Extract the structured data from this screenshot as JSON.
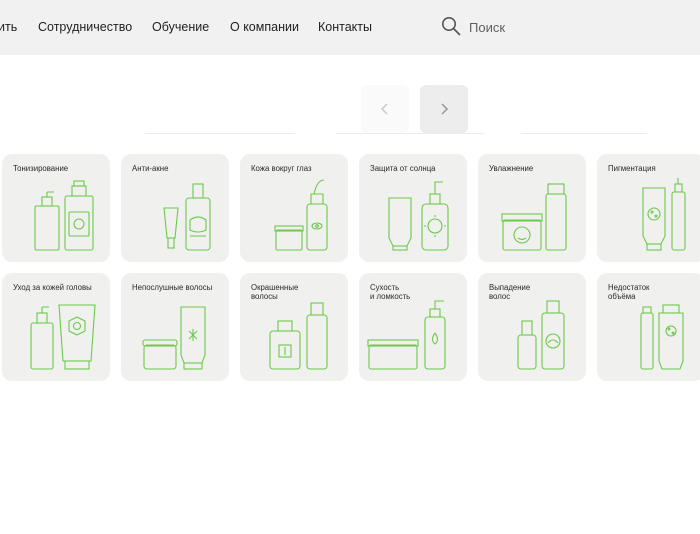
{
  "header": {
    "nav": [
      {
        "id": "nav-item-partial",
        "label": "ить"
      },
      {
        "id": "nav-item-cooperation",
        "label": "Сотрудничество"
      },
      {
        "id": "nav-item-education",
        "label": "Обучение"
      },
      {
        "id": "nav-item-about",
        "label": "О компании"
      },
      {
        "id": "nav-item-contacts",
        "label": "Контакты"
      }
    ],
    "search": {
      "label": "Поиск",
      "icon": "search-icon"
    }
  },
  "carousel": {
    "prev_icon": "chevron-left-icon",
    "next_icon": "chevron-right-icon"
  },
  "accent_color": "#6cc94c",
  "categories": [
    {
      "label": "Тонизирование"
    },
    {
      "label": "Анти-акне"
    },
    {
      "label": "Кожа вокруг глаз"
    },
    {
      "label": "Защита от солнца"
    },
    {
      "label": "Увлажнение"
    },
    {
      "label": "Пигментация"
    },
    {
      "label": "Уход за кожей головы"
    },
    {
      "label": "Непослушные волосы"
    },
    {
      "label": "Окрашенные\nволосы"
    },
    {
      "label": "Сухость\nи ломкость"
    },
    {
      "label": "Выпадение\nволос"
    },
    {
      "label": "Недостаток\nобъёма"
    }
  ]
}
